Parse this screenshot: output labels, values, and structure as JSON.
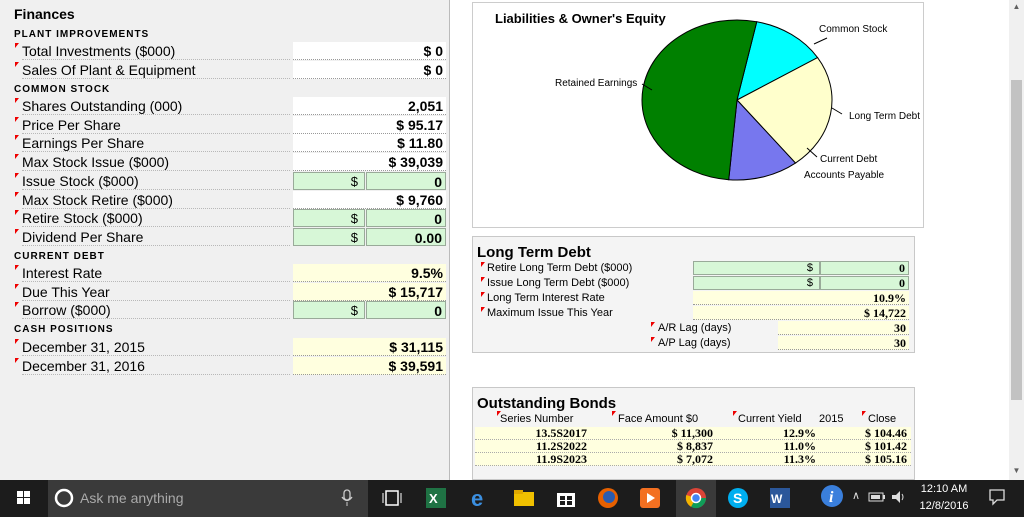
{
  "finances": {
    "title": "Finances",
    "plant": {
      "header": "PLANT IMPROVEMENTS",
      "rows": [
        {
          "label": "Total Investments ($000)",
          "value": "$ 0"
        },
        {
          "label": "Sales Of Plant & Equipment",
          "value": "$ 0"
        }
      ]
    },
    "common": {
      "header": "COMMON STOCK",
      "rows": [
        {
          "label": "Shares Outstanding (000)",
          "value": "2,051"
        },
        {
          "label": "Price Per Share",
          "value": "$ 95.17"
        },
        {
          "label": "Earnings Per Share",
          "value": "$ 11.80"
        },
        {
          "label": "Max Stock Issue ($000)",
          "value": "$ 39,039"
        },
        {
          "label": "Issue Stock ($000)",
          "dollar": "$",
          "value": "0"
        },
        {
          "label": "Max Stock Retire ($000)",
          "value": "$ 9,760"
        },
        {
          "label": "Retire Stock ($000)",
          "dollar": "$",
          "value": "0"
        },
        {
          "label": "Dividend Per Share",
          "dollar": "$",
          "value": "0.00"
        }
      ]
    },
    "debt": {
      "header": "CURRENT DEBT",
      "rows": [
        {
          "label": "Interest Rate",
          "value": "9.5%"
        },
        {
          "label": "Due This Year",
          "value": "$ 15,717"
        },
        {
          "label": "Borrow ($000)",
          "dollar": "$",
          "value": "0"
        }
      ]
    },
    "cash": {
      "header": "CASH POSITIONS",
      "rows": [
        {
          "label": "December 31, 2015",
          "value": "$ 31,115"
        },
        {
          "label": "December 31, 2016",
          "value": "$ 39,591"
        }
      ]
    }
  },
  "pie": {
    "title": "Liabilities & Owner's Equity",
    "labels": {
      "common": "Common Stock",
      "retained": "Retained Earnings",
      "ltd": "Long Term Debt",
      "current": "Current Debt",
      "ap": "Accounts Payable"
    },
    "colors": {
      "retained": "#008000",
      "common": "#00ffff",
      "ltd": "#ffffcc",
      "current": "#7777ee"
    }
  },
  "ltd": {
    "title": "Long Term Debt",
    "rows": [
      {
        "label": "Retire Long Term Debt ($000)",
        "dollar": "$",
        "value": "0"
      },
      {
        "label": "Issue Long Term Debt ($000)",
        "dollar": "$",
        "value": "0"
      },
      {
        "label": "Long Term Interest Rate",
        "value": "10.9%"
      },
      {
        "label": "Maximum Issue This Year",
        "value": "$ 14,722"
      }
    ],
    "lags": [
      {
        "label": "A/R Lag (days)",
        "value": "30"
      },
      {
        "label": "A/P Lag (days)",
        "value": "30"
      }
    ]
  },
  "bonds": {
    "title": "Outstanding Bonds",
    "columns": {
      "series": "Series Number",
      "face": "Face Amount $0",
      "yield": "Current Yield",
      "year": "2015",
      "close": "Close"
    },
    "rows": [
      {
        "series": "13.5S2017",
        "face": "$ 11,300",
        "yield": "12.9%",
        "close": "$ 104.46"
      },
      {
        "series": "11.2S2022",
        "face": "$ 8,837",
        "yield": "11.0%",
        "close": "$ 101.42"
      },
      {
        "series": "11.9S2023",
        "face": "$ 7,072",
        "yield": "11.3%",
        "close": "$ 105.16"
      }
    ]
  },
  "taskbar": {
    "search_placeholder": "Ask me anything",
    "time": "12:10 AM",
    "date": "12/8/2016",
    "icons": [
      "windows-start-icon",
      "cortana-icon",
      "microphone-icon",
      "task-view-icon",
      "excel-icon",
      "edge-icon",
      "file-explorer-icon",
      "store-icon",
      "firefox-icon",
      "media-player-icon",
      "chrome-icon",
      "skype-icon",
      "word-icon",
      "info-icon"
    ]
  }
}
